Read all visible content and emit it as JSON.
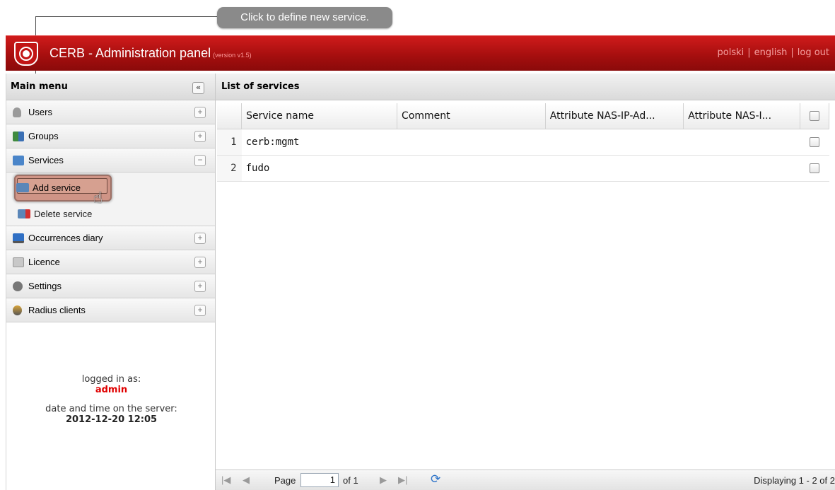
{
  "callout": {
    "text": "Click to define new service."
  },
  "header": {
    "title": "CERB - Administration panel",
    "version": "(version v1.5)",
    "links": [
      "polski",
      "english",
      "log out"
    ],
    "color": "#b81212"
  },
  "sidebar": {
    "title": "Main menu",
    "collapse_icon": "double-chevron-left-icon",
    "items": [
      {
        "label": "Users",
        "icon": "user-icon",
        "toggle": "+"
      },
      {
        "label": "Groups",
        "icon": "group-icon",
        "toggle": "+"
      },
      {
        "label": "Services",
        "icon": "services-icon",
        "toggle": "−"
      },
      {
        "label": "Occurrences diary",
        "icon": "monitor-icon",
        "toggle": "+"
      },
      {
        "label": "Licence",
        "icon": "licence-icon",
        "toggle": "+"
      },
      {
        "label": "Settings",
        "icon": "gear-icon",
        "toggle": "+"
      },
      {
        "label": "Radius clients",
        "icon": "radius-icon",
        "toggle": "+"
      }
    ],
    "submenu": [
      {
        "label": "Add service",
        "icon": "add-service-icon"
      },
      {
        "label": "Delete service",
        "icon": "delete-service-icon"
      }
    ],
    "login": {
      "label": "logged in as:",
      "user": "admin",
      "time_label": "date and time on the server:",
      "time": "2012-12-20 12:05"
    }
  },
  "main": {
    "title": "List of services",
    "columns": [
      "Service name",
      "Comment",
      "Attribute NAS-IP-Ad...",
      "Attribute NAS-I..."
    ],
    "rows": [
      {
        "num": "1",
        "service": "cerb:mgmt",
        "comment": "",
        "nas_ip": "",
        "nas_id": ""
      },
      {
        "num": "2",
        "service": "fudo",
        "comment": "",
        "nas_ip": "",
        "nas_id": ""
      }
    ],
    "pager": {
      "page_label": "Page",
      "page_value": "1",
      "of_label": "of 1",
      "display_text": "Displaying 1 - 2 of 2"
    }
  }
}
